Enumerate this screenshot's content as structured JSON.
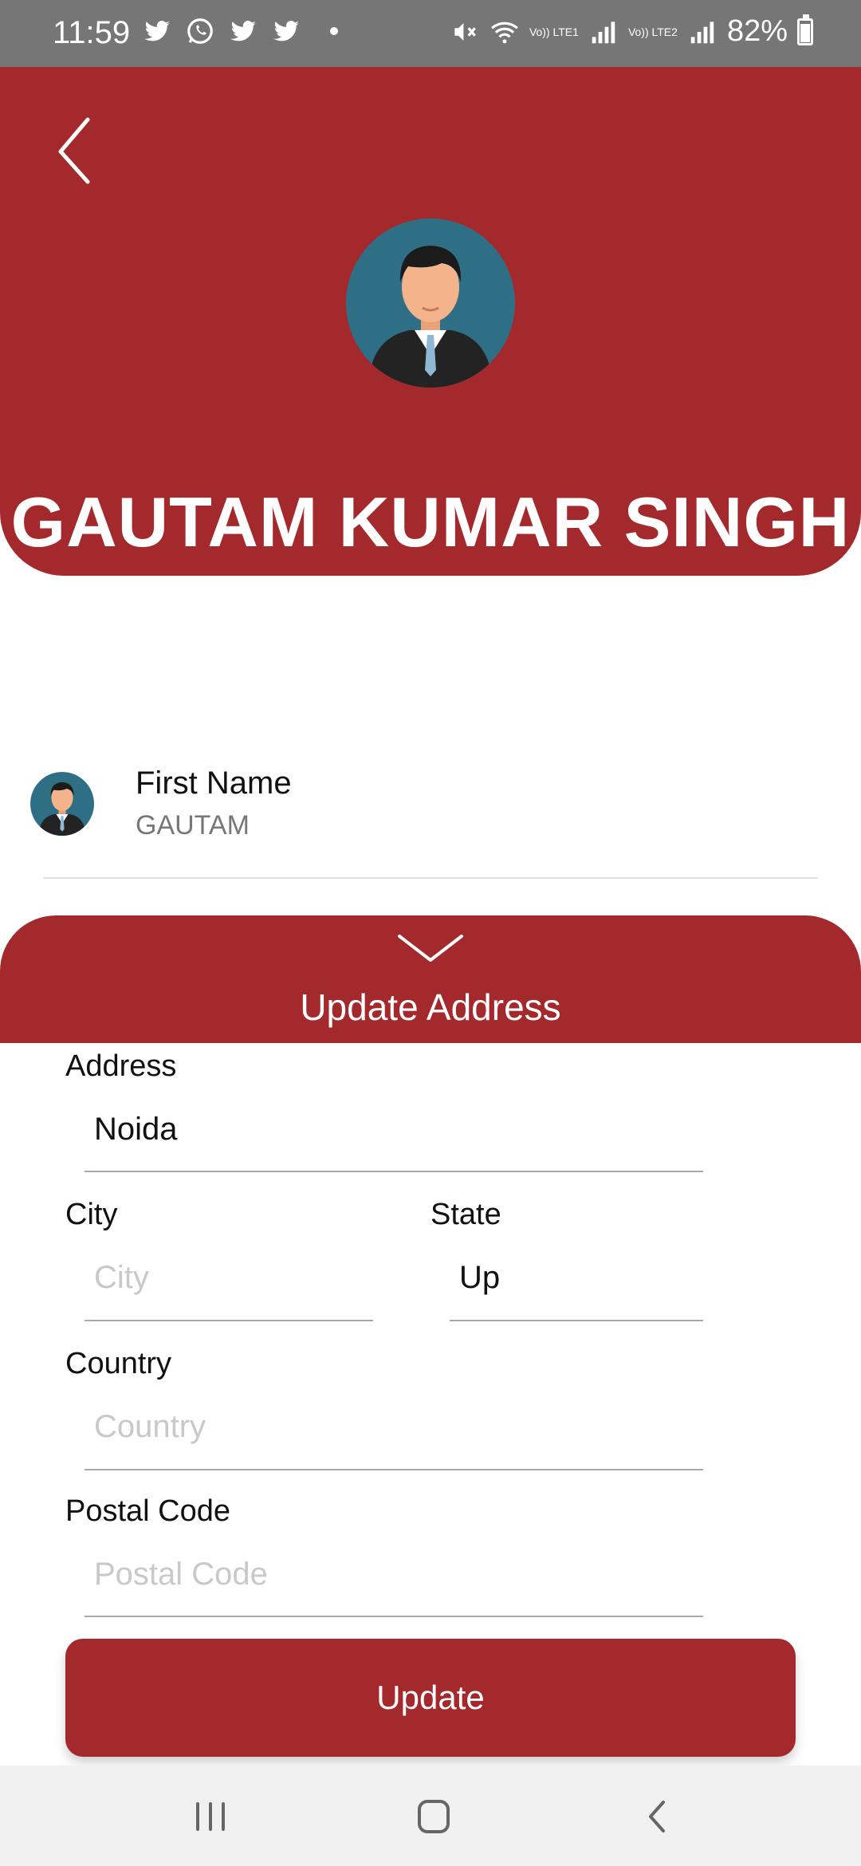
{
  "status_bar": {
    "time": "11:59",
    "battery": "82%",
    "battery_level": 0.82,
    "lte1": "Vo)) LTE1",
    "lte2": "Vo)) LTE2",
    "icons": [
      "twitter-icon",
      "whatsapp-icon",
      "twitter-icon",
      "twitter-icon",
      "notification-dot-icon",
      "mute-icon",
      "wifi-icon",
      "signal-icon",
      "signal-icon",
      "battery-icon"
    ]
  },
  "header": {
    "user_name": "GAUTAM KUMAR SINGH",
    "back_icon": "back-chevron-icon",
    "avatar_icon": "user-avatar-icon"
  },
  "profile": {
    "first_name_label": "First Name",
    "first_name_value": "GAUTAM"
  },
  "update_panel": {
    "title": "Update Address",
    "collapse_icon": "chevron-down-icon"
  },
  "form": {
    "address": {
      "label": "Address",
      "value": "Noida",
      "placeholder": ""
    },
    "city": {
      "label": "City",
      "value": "",
      "placeholder": "City"
    },
    "state": {
      "label": "State",
      "value": "Up",
      "placeholder": ""
    },
    "country": {
      "label": "Country",
      "value": "",
      "placeholder": "Country"
    },
    "postal_code": {
      "label": "Postal Code",
      "value": "",
      "placeholder": "Postal Code"
    }
  },
  "actions": {
    "update_label": "Update"
  },
  "nav_bar": {
    "icons": [
      "recent-apps-icon",
      "home-icon",
      "back-icon"
    ]
  },
  "colors": {
    "accent": "#a4292c",
    "status_bar": "#767676",
    "nav_bar": "#f1f1f1"
  }
}
